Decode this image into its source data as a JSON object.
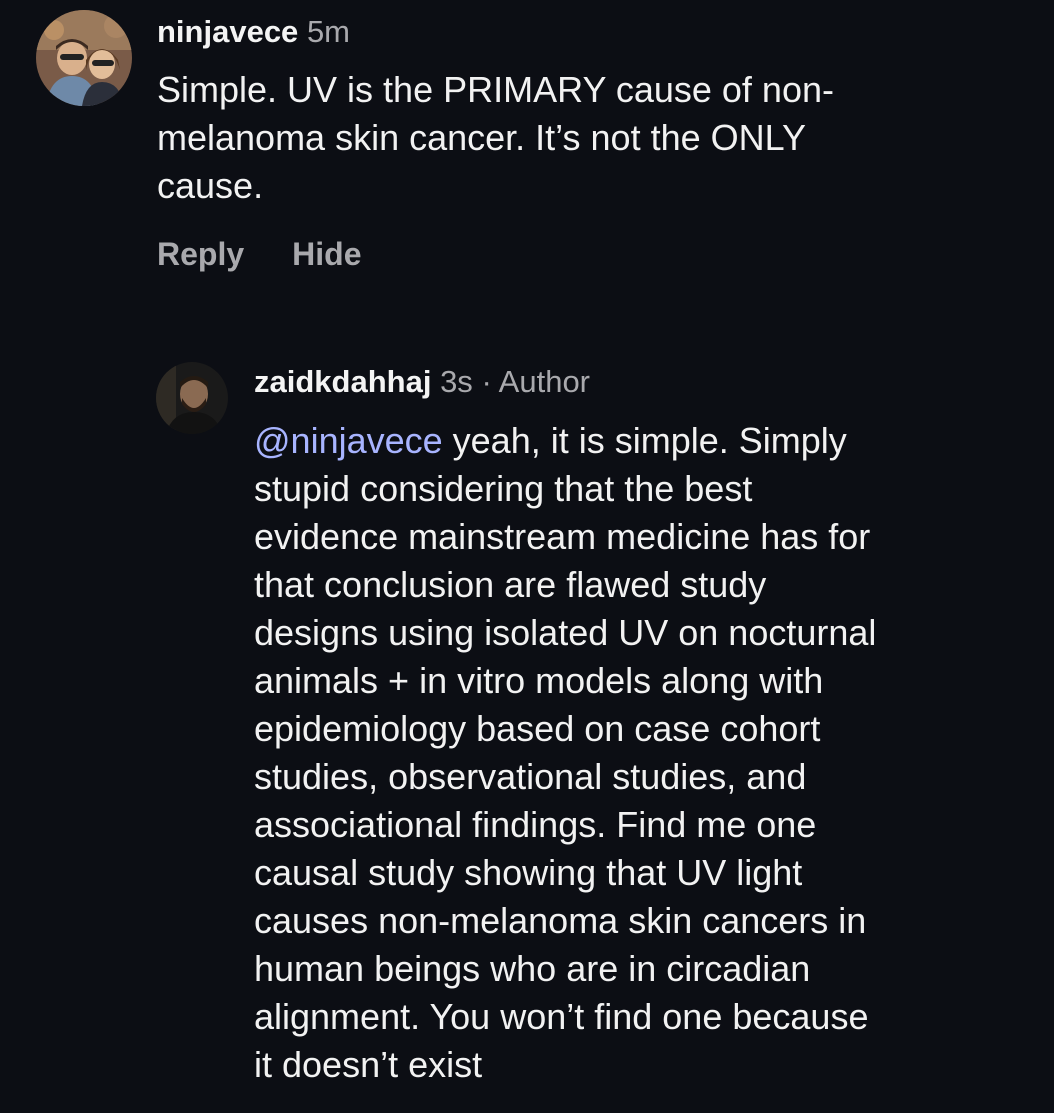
{
  "comment_primary": {
    "username": "ninjavece",
    "time": "5m",
    "text": "Simple. UV is the PRIMARY cause of non-\nmelanoma skin cancer. It’s not the ONLY\ncause.",
    "actions": {
      "reply_label": "Reply",
      "hide_label": "Hide"
    },
    "avatar_icon": "profile-photo-two-people"
  },
  "comment_reply": {
    "username": "zaidkdahhaj",
    "time": "3s",
    "separator": "·",
    "author_tag": "Author",
    "mention": "@ninjavece",
    "text": " yeah, it is simple. Simply\nstupid considering that the best\nevidence mainstream medicine has for\nthat conclusion are flawed study\ndesigns using isolated UV on nocturnal\nanimals + in vitro models along with\nepidemiology based on case cohort\nstudies, observational studies, and\nassociational findings. Find me one\ncausal study showing that UV light\ncauses non-melanoma skin cancers in\nhuman beings who are in circadian\nalignment. You won’t find one because\nit doesn’t exist",
    "avatar_icon": "profile-photo-person"
  },
  "colors": {
    "background": "#0c0e14",
    "text": "#f2f2f2",
    "muted": "#a9a9ad",
    "mention": "#a8b4ff"
  }
}
